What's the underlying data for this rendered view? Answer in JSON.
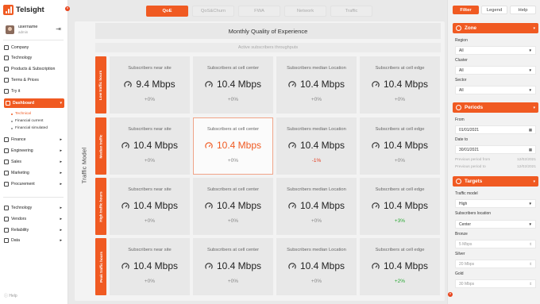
{
  "brand": {
    "name": "Telsight",
    "accent": "#f05a22"
  },
  "user": {
    "name": "username",
    "role": "admin"
  },
  "nav": {
    "top": [
      "Company",
      "Technology",
      "Products & Subscription",
      "Terms & Prices",
      "Try it"
    ],
    "active": "Dashboard",
    "sub": [
      "Technical",
      "Financial current",
      "Financial simulated"
    ],
    "groups": [
      "Finance",
      "Engineering",
      "Sales",
      "Marketing",
      "Procurement"
    ],
    "bottom": [
      "Technology",
      "Vendors",
      "Reliability",
      "Data"
    ],
    "help": "Help"
  },
  "tabs": [
    "QoE",
    "QoS&Churn",
    "FWA",
    "Network",
    "Traffic"
  ],
  "main": {
    "title": "Monthly Quality of Experience",
    "subtitle": "Active subscribers throughputs",
    "axis_label": "Traffic Model",
    "rows": [
      {
        "label": "Low traffic hours",
        "cells": [
          {
            "title": "Subscribers near site",
            "value": "9.4 Mbps",
            "delta": "+0%"
          },
          {
            "title": "Subscribers at cell center",
            "value": "10.4 Mbps",
            "delta": "+0%"
          },
          {
            "title": "Subscribers median Location",
            "value": "10.4 Mbps",
            "delta": "+0%"
          },
          {
            "title": "Subscribers at cell edge",
            "value": "10.4 Mbps",
            "delta": "+0%"
          }
        ]
      },
      {
        "label": "Median traffic",
        "cells": [
          {
            "title": "Subscribers near site",
            "value": "10.4 Mbps",
            "delta": "+0%"
          },
          {
            "title": "Subscribers at cell center",
            "value": "10.4 Mbps",
            "delta": "+0%"
          },
          {
            "title": "Subscribers median Location",
            "value": "10.4 Mbps",
            "delta": "-1%"
          },
          {
            "title": "Subscribers at cell edge",
            "value": "10.4 Mbps",
            "delta": "+0%"
          }
        ]
      },
      {
        "label": "High traffic hours",
        "cells": [
          {
            "title": "Subscribers near site",
            "value": "10.4 Mbps",
            "delta": "+0%"
          },
          {
            "title": "Subscribers at cell center",
            "value": "10.4 Mbps",
            "delta": "+0%"
          },
          {
            "title": "Subscribers median Location",
            "value": "10.4 Mbps",
            "delta": "+0%"
          },
          {
            "title": "Subscribers at cell edge",
            "value": "10.4 Mbps",
            "delta": "+3%"
          }
        ]
      },
      {
        "label": "Peak traffic hours",
        "cells": [
          {
            "title": "Subscribers near site",
            "value": "10.4 Mbps",
            "delta": "+0%"
          },
          {
            "title": "Subscribers at cell center",
            "value": "10.4 Mbps",
            "delta": "+0%"
          },
          {
            "title": "Subscribers median Location",
            "value": "10.4 Mbps",
            "delta": "+0%"
          },
          {
            "title": "Subscribers at cell edge",
            "value": "10.4 Mbps",
            "delta": "+2%"
          }
        ]
      }
    ]
  },
  "panel": {
    "tabs": [
      "Filter",
      "Legend",
      "Help"
    ],
    "zone": {
      "title": "Zone",
      "region_label": "Region",
      "region": "All",
      "cluster_label": "Cluster",
      "cluster": "All",
      "sector_label": "Sector",
      "sector": "All"
    },
    "periods": {
      "title": "Periods",
      "from_label": "From",
      "from": "01/01/2021",
      "to_label": "Date to",
      "to": "30/01/2021",
      "prev_from_label": "Previous period from",
      "prev_from": "12/02/2021",
      "prev_to_label": "Previous period to",
      "prev_to": "12/02/2021"
    },
    "targets": {
      "title": "Targets",
      "model_label": "Traffic model",
      "model": "High",
      "loc_label": "Subscribers location",
      "loc": "Center",
      "bronze_label": "Bronze",
      "bronze": "5 Mbps",
      "silver_label": "Silver",
      "silver": "20 Mbps",
      "gold_label": "Gold",
      "gold": "30 Mbps"
    }
  }
}
